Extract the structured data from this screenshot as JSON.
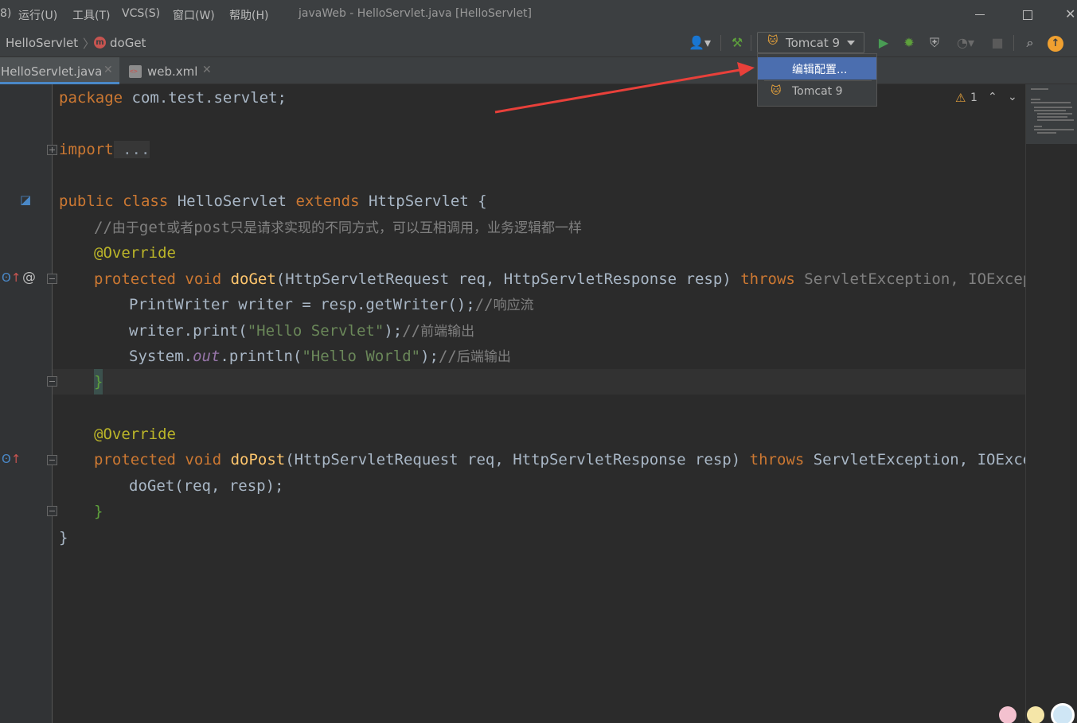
{
  "menubar": {
    "items": [
      "8)",
      "运行(U)",
      "工具(T)",
      "VCS(S)",
      "窗口(W)",
      "帮助(H)"
    ],
    "title": "javaWeb - HelloServlet.java [HelloServlet]"
  },
  "navbar": {
    "crumb_class": "HelloServlet",
    "method_badge": "m",
    "crumb_method": "doGet",
    "run_config": "Tomcat 9"
  },
  "tabs": [
    {
      "label": "HelloServlet.java"
    },
    {
      "label": "web.xml"
    }
  ],
  "popup": {
    "items": [
      "编辑配置...",
      "Tomcat 9"
    ]
  },
  "inspection": {
    "warning_count": "1"
  },
  "code": {
    "l1_kw": "package",
    "l1_rest": " com.test.servlet;",
    "l3_kw": "import",
    "l3_dots": " ...",
    "l5_a": "public class",
    "l5_b": " HelloServlet ",
    "l5_c": "extends",
    "l5_d": " HttpServlet {",
    "l6_slash": "//",
    "l6_a": "由于",
    "l6_b": "get",
    "l6_c": "或者",
    "l6_d": "post",
    "l6_e": "只是请求实现的不同方式，可以互相调用，业务逻辑都一样",
    "l7": "@Override",
    "l8_kw": "protected void",
    "l8_fn": " doGet",
    "l8_rest": "(HttpServletRequest req, HttpServletResponse resp) ",
    "l8_throws": "throws",
    "l8_exc": " ServletException, IOException",
    "l9_code": "PrintWriter writer = resp.getWriter();",
    "l9_slash": "//",
    "l9_cmt": "响应流",
    "l10_a": "writer.print(",
    "l10_str": "\"Hello Servlet\"",
    "l10_b": ");",
    "l10_slash": "//",
    "l10_cmt": "前端输出",
    "l11_a": "System.",
    "l11_out": "out",
    "l11_b": ".println(",
    "l11_str": "\"Hello World\"",
    "l11_c": ");",
    "l11_slash": "//",
    "l11_cmt": "后端输出",
    "l12": "}",
    "l14": "@Override",
    "l15_kw": "protected void",
    "l15_fn": " doPost",
    "l15_rest": "(HttpServletRequest req, HttpServletResponse resp) ",
    "l15_throws": "throws",
    "l15_exc": " ServletException, IOExceptio",
    "l16": "doGet(req, resp);",
    "l17": "}",
    "l18": "}"
  },
  "colors": {
    "keyword": "#cc7832",
    "string": "#6a8759",
    "annotation": "#bbb529",
    "function": "#ffc66d",
    "comment": "#808080",
    "selection": "#4b6eaf",
    "arrow": "#e8403a"
  },
  "icons": {
    "user": "user-icon",
    "build": "hammer-icon",
    "run": "run-icon",
    "debug": "debug-icon",
    "coverage": "coverage-icon",
    "profile": "profile-icon",
    "stop": "stop-icon",
    "search": "search-icon",
    "update": "update-icon"
  }
}
